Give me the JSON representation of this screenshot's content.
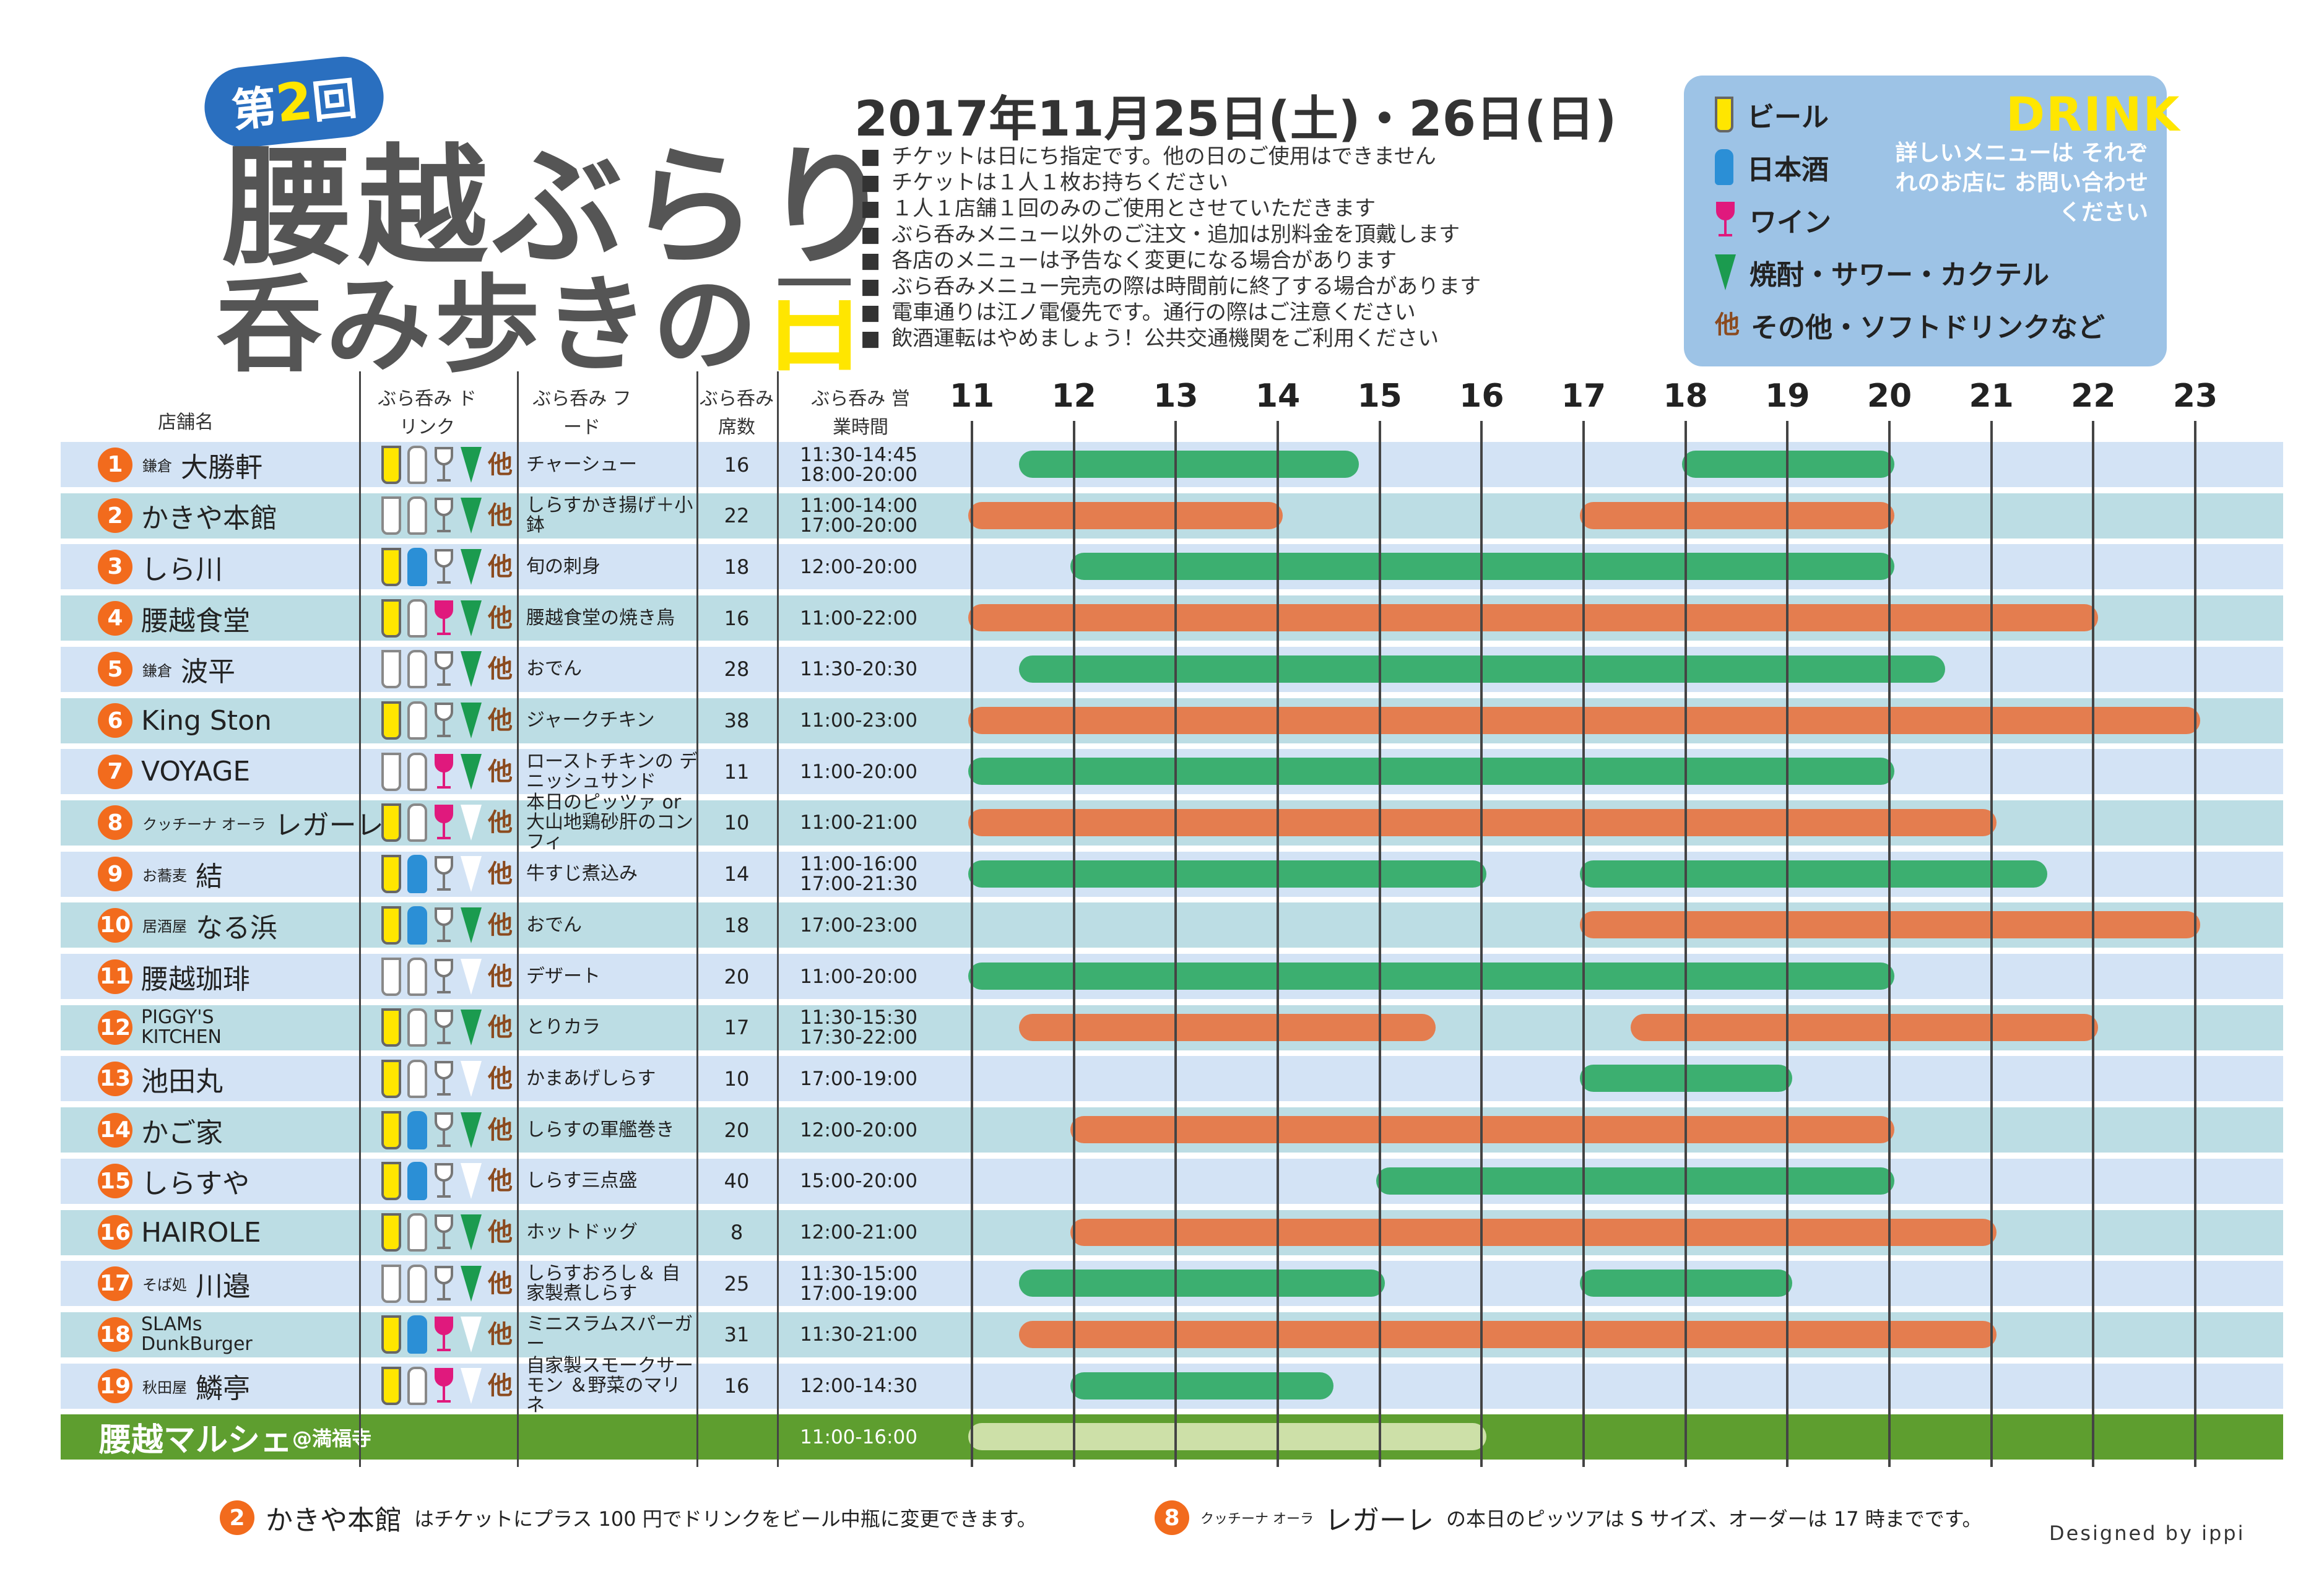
{
  "logo": {
    "round": "第2回",
    "round_prefix": "第",
    "round_num": "2",
    "round_suffix": "回",
    "line1": "腰越ぶらり",
    "line2_main": "呑み歩きの",
    "line2_end": "日"
  },
  "event_date": "2017年11月25日(土)・26日(日)",
  "notes": [
    "チケットは日にち指定です。他の日のご使用はできません",
    "チケットは１人１枚お持ちください",
    "１人１店舗１回のみのご使用とさせていただきます",
    "ぶら呑みメニュー以外のご注文・追加は別料金を頂戴します",
    "各店のメニューは予告なく変更になる場合があります",
    "ぶら呑みメニュー完売の際は時間前に終了する場合があります",
    "電車通りは江ノ電優先です。通行の際はご注意ください",
    "飲酒運転はやめましょう！公共交通機関をご利用ください"
  ],
  "drink_legend": {
    "title": "DRINK",
    "note": "詳しいメニューは それぞれのお店に お問い合わせください",
    "items": [
      {
        "icon": "beer-icon",
        "label": "ビール"
      },
      {
        "icon": "sake-icon",
        "label": "日本酒"
      },
      {
        "icon": "wine-icon",
        "label": "ワイン"
      },
      {
        "icon": "sour-icon",
        "label": "焼酎・サワー・カクテル"
      },
      {
        "icon": "other-icon",
        "label": "その他・ソフトドリンクなど"
      }
    ],
    "other_glyph": "他"
  },
  "headers": {
    "shop": "店舗名",
    "drink": "ぶら呑み ドリンク",
    "food": "ぶら呑み フード",
    "seats": "ぶら呑み 席数",
    "hours": "ぶら呑み 営業時間"
  },
  "hours_axis": [
    "11",
    "12",
    "13",
    "14",
    "15",
    "16",
    "17",
    "18",
    "19",
    "20",
    "21",
    "22",
    "23"
  ],
  "colors": {
    "green_bar": "#3caf70",
    "orange_bar": "#e47d4f",
    "marche_bar": "#cde0a8",
    "badge": "#f26b1d",
    "row_blue": "#d3e3f5",
    "row_teal": "#bcdde4",
    "marche_row": "#5e9e2f"
  },
  "shops": [
    {
      "no": "1",
      "prefix": "鎌倉",
      "name": "大勝軒",
      "drinks": [
        1,
        0,
        0,
        1,
        1
      ],
      "food": "チャーシュー",
      "seats": "16",
      "hours": "11:30-14:45\n18:00-20:00",
      "bars": [
        {
          "s": 11.5,
          "e": 14.75,
          "c": "g"
        },
        {
          "s": 18.0,
          "e": 20.0,
          "c": "g"
        }
      ]
    },
    {
      "no": "2",
      "prefix": "",
      "name": "かきや本館",
      "drinks": [
        0,
        0,
        0,
        1,
        1
      ],
      "food": "しらすかき揚げ＋小鉢",
      "seats": "22",
      "hours": "11:00-14:00\n17:00-20:00",
      "bars": [
        {
          "s": 11.0,
          "e": 14.0,
          "c": "o"
        },
        {
          "s": 17.0,
          "e": 20.0,
          "c": "o"
        }
      ]
    },
    {
      "no": "3",
      "prefix": "",
      "name": "しら川",
      "drinks": [
        1,
        1,
        0,
        1,
        1
      ],
      "food": "旬の刺身",
      "seats": "18",
      "hours": "12:00-20:00",
      "bars": [
        {
          "s": 12.0,
          "e": 20.0,
          "c": "g"
        }
      ]
    },
    {
      "no": "4",
      "prefix": "",
      "name": "腰越食堂",
      "drinks": [
        1,
        0,
        1,
        1,
        1
      ],
      "food": "腰越食堂の焼き鳥",
      "seats": "16",
      "hours": "11:00-22:00",
      "bars": [
        {
          "s": 11.0,
          "e": 22.0,
          "c": "o"
        }
      ]
    },
    {
      "no": "5",
      "prefix": "鎌倉",
      "name": "波平",
      "drinks": [
        0,
        0,
        0,
        1,
        1
      ],
      "food": "おでん",
      "seats": "28",
      "hours": "11:30-20:30",
      "bars": [
        {
          "s": 11.5,
          "e": 20.5,
          "c": "g"
        }
      ]
    },
    {
      "no": "6",
      "prefix": "",
      "name": "King Ston",
      "drinks": [
        1,
        0,
        0,
        1,
        1
      ],
      "food": "ジャークチキン",
      "seats": "38",
      "hours": "11:00-23:00",
      "bars": [
        {
          "s": 11.0,
          "e": 23.0,
          "c": "o"
        }
      ]
    },
    {
      "no": "7",
      "prefix": "",
      "name": "VOYAGE",
      "drinks": [
        0,
        0,
        1,
        1,
        1
      ],
      "food": "ローストチキンの デニッシュサンド",
      "seats": "11",
      "hours": "11:00-20:00",
      "bars": [
        {
          "s": 11.0,
          "e": 20.0,
          "c": "g"
        }
      ]
    },
    {
      "no": "8",
      "prefix": "クッチーナ オーラ",
      "name": "レガーレ",
      "drinks": [
        1,
        0,
        1,
        0,
        1
      ],
      "food": "本日のピッツァ or 大山地鶏砂肝のコンフィ",
      "seats": "10",
      "hours": "11:00-21:00",
      "bars": [
        {
          "s": 11.0,
          "e": 21.0,
          "c": "o"
        }
      ]
    },
    {
      "no": "9",
      "prefix": "お蕎麦",
      "name": "結",
      "drinks": [
        1,
        1,
        0,
        0,
        1
      ],
      "food": "牛すじ煮込み",
      "seats": "14",
      "hours": "11:00-16:00\n17:00-21:30",
      "bars": [
        {
          "s": 11.0,
          "e": 16.0,
          "c": "g"
        },
        {
          "s": 17.0,
          "e": 21.5,
          "c": "g"
        }
      ]
    },
    {
      "no": "10",
      "prefix": "居酒屋",
      "name": "なる浜",
      "drinks": [
        1,
        1,
        0,
        1,
        1
      ],
      "food": "おでん",
      "seats": "18",
      "hours": "17:00-23:00",
      "bars": [
        {
          "s": 17.0,
          "e": 23.0,
          "c": "o"
        }
      ]
    },
    {
      "no": "11",
      "prefix": "",
      "name": "腰越珈琲",
      "drinks": [
        0,
        0,
        0,
        0,
        1
      ],
      "food": "デザート",
      "seats": "20",
      "hours": "11:00-20:00",
      "bars": [
        {
          "s": 11.0,
          "e": 20.0,
          "c": "g"
        }
      ]
    },
    {
      "no": "12",
      "prefix": "",
      "name": "PIGGY'S KITCHEN",
      "drinks": [
        1,
        0,
        0,
        1,
        1
      ],
      "food": "とりカラ",
      "seats": "17",
      "hours": "11:30-15:30\n17:30-22:00",
      "bars": [
        {
          "s": 11.5,
          "e": 15.5,
          "c": "o"
        },
        {
          "s": 17.5,
          "e": 22.0,
          "c": "o"
        }
      ]
    },
    {
      "no": "13",
      "prefix": "",
      "name": "池田丸",
      "drinks": [
        1,
        0,
        0,
        0,
        1
      ],
      "food": "かまあげしらす",
      "seats": "10",
      "hours": "17:00-19:00",
      "bars": [
        {
          "s": 17.0,
          "e": 19.0,
          "c": "g"
        }
      ]
    },
    {
      "no": "14",
      "prefix": "",
      "name": "かご家",
      "drinks": [
        1,
        1,
        0,
        1,
        1
      ],
      "food": "しらすの軍艦巻き",
      "seats": "20",
      "hours": "12:00-20:00",
      "bars": [
        {
          "s": 12.0,
          "e": 20.0,
          "c": "o"
        }
      ]
    },
    {
      "no": "15",
      "prefix": "",
      "name": "しらすや",
      "drinks": [
        1,
        1,
        0,
        0,
        1
      ],
      "food": "しらす三点盛",
      "seats": "40",
      "hours": "15:00-20:00",
      "bars": [
        {
          "s": 15.0,
          "e": 20.0,
          "c": "g"
        }
      ]
    },
    {
      "no": "16",
      "prefix": "",
      "name": "HAIROLE",
      "drinks": [
        1,
        0,
        0,
        1,
        1
      ],
      "food": "ホットドッグ",
      "seats": "8",
      "hours": "12:00-21:00",
      "bars": [
        {
          "s": 12.0,
          "e": 21.0,
          "c": "o"
        }
      ]
    },
    {
      "no": "17",
      "prefix": "そば処",
      "name": "川邉",
      "drinks": [
        0,
        0,
        0,
        1,
        1
      ],
      "food": "しらすおろし＆ 自家製煮しらす",
      "seats": "25",
      "hours": "11:30-15:00\n17:00-19:00",
      "bars": [
        {
          "s": 11.5,
          "e": 15.0,
          "c": "g"
        },
        {
          "s": 17.0,
          "e": 19.0,
          "c": "g"
        }
      ]
    },
    {
      "no": "18",
      "prefix": "",
      "name": "SLAMs DunkBurger",
      "drinks": [
        1,
        1,
        1,
        0,
        1
      ],
      "food": "ミニスラムスパーガー",
      "seats": "31",
      "hours": "11:30-21:00",
      "bars": [
        {
          "s": 11.5,
          "e": 21.0,
          "c": "o"
        }
      ]
    },
    {
      "no": "19",
      "prefix": "秋田屋",
      "name": "鱗亭",
      "drinks": [
        1,
        0,
        1,
        0,
        1
      ],
      "food": "自家製スモークサーモン ＆野菜のマリネ",
      "seats": "16",
      "hours": "12:00-14:30",
      "bars": [
        {
          "s": 12.0,
          "e": 14.5,
          "c": "g"
        }
      ]
    }
  ],
  "marche": {
    "name": "腰越マルシェ",
    "place": "@満福寺",
    "hours": "11:00-16:00",
    "bars": [
      {
        "s": 11.0,
        "e": 16.0,
        "c": "l"
      }
    ]
  },
  "footer": {
    "a_no": "2",
    "a_name": "かきや本館",
    "a_text": "はチケットにプラス 100 円でドリンクをビール中瓶に変更できます。",
    "b_no": "8",
    "b_prefix": "クッチーナ オーラ",
    "b_name": "レガーレ",
    "b_text": "の本日のピッツアは S サイズ、オーダーは 17 時までです。",
    "designer": "Designed by ippi"
  }
}
